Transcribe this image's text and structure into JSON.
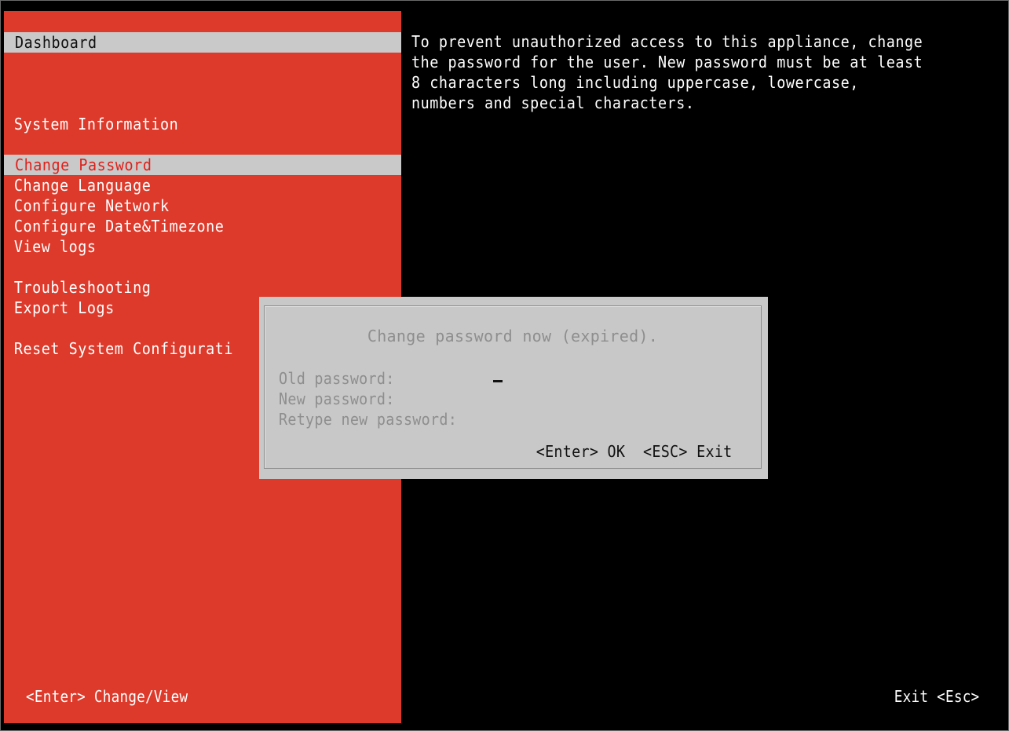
{
  "menu": {
    "items": [
      {
        "label": "Dashboard",
        "state": "highlighted"
      },
      {
        "label": "System Information"
      },
      {
        "label": "Change Password",
        "state": "selected"
      },
      {
        "label": "Change Language"
      },
      {
        "label": "Configure Network"
      },
      {
        "label": "Configure Date&Timezone"
      },
      {
        "label": "View logs"
      },
      {
        "label": "Troubleshooting"
      },
      {
        "label": "Export Logs"
      },
      {
        "label": "Reset System Configurati"
      }
    ]
  },
  "info_text": "To prevent unauthorized access to this appliance, change\nthe password for the user. New password must be at least\n8 characters long including uppercase, lowercase,\nnumbers and special characters.",
  "dialog": {
    "title": "Change password now (expired).",
    "old_password_label": "Old password:",
    "new_password_label": "New password:",
    "retype_password_label": "Retype new password:",
    "ok_label": "<Enter> OK",
    "exit_label": "<ESC> Exit"
  },
  "footer": {
    "left": "<Enter> Change/View",
    "right": "Exit <Esc>"
  },
  "colors": {
    "panel": "#dd3a2b",
    "highlight": "#c9c9c9",
    "selected_text": "#e0201a",
    "background": "#000000"
  }
}
